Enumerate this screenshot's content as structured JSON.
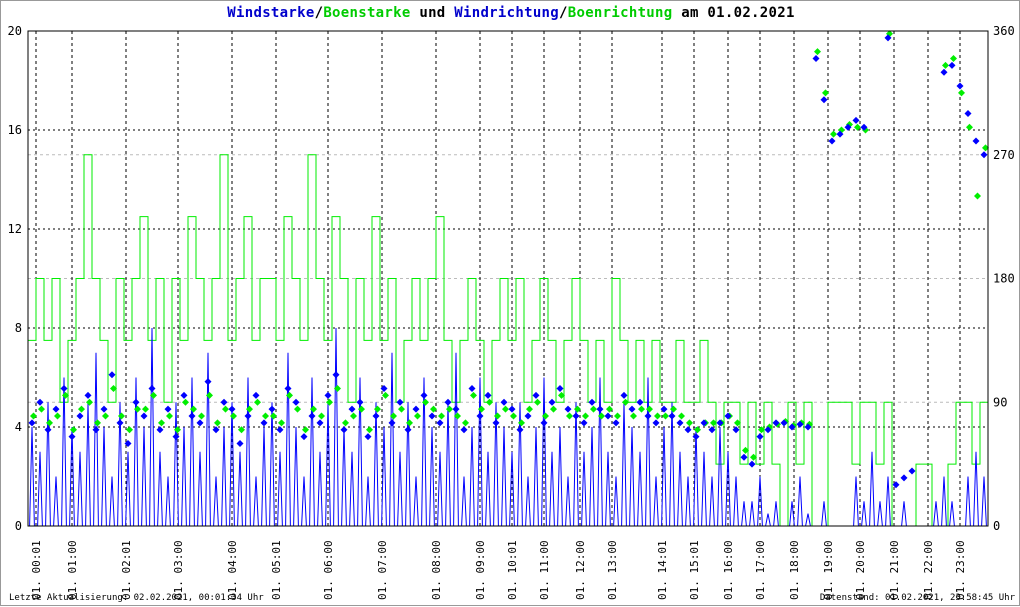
{
  "title": {
    "p1": "Windstarke",
    "s1": "/",
    "p2": "Boenstarke",
    "s2": " und ",
    "p3": "Windrichtung",
    "s3": "/",
    "p4": "Boenrichtung",
    "s4": " am 01.02.2021"
  },
  "footer": {
    "left": "Letzte Aktualisierung: 02.02.2021, 00:01:34 Uhr",
    "right": "Datenstand: 01.02.2021, 23:58:45 Uhr"
  },
  "colors": {
    "speed": "#0000ff",
    "gust": "#00ee00",
    "grid": "#000000",
    "grid_minor": "#bbbbbb"
  },
  "chart_data": {
    "type": "line",
    "title": "Windstarke/Boenstarke und Windrichtung/Boenrichtung am 01.02.2021",
    "x_samples": 120,
    "y_left": {
      "min": 0,
      "max": 20,
      "ticks": [
        0,
        4,
        8,
        12,
        16,
        20
      ]
    },
    "y_right": {
      "min": 0,
      "max": 360,
      "ticks": [
        0,
        90,
        180,
        270,
        360
      ]
    },
    "x_ticks": [
      {
        "pos": 0.5,
        "label": "01. 00:01"
      },
      {
        "pos": 5,
        "label": "01. 01:00"
      },
      {
        "pos": 11.75,
        "label": "01. 02:01"
      },
      {
        "pos": 18.25,
        "label": "01. 03:00"
      },
      {
        "pos": 25,
        "label": "01. 04:00"
      },
      {
        "pos": 30.5,
        "label": "01. 05:01"
      },
      {
        "pos": 37,
        "label": "01. 06:00"
      },
      {
        "pos": 43.75,
        "label": "01. 07:00"
      },
      {
        "pos": 50.5,
        "label": "01. 08:00"
      },
      {
        "pos": 56,
        "label": "01. 09:00"
      },
      {
        "pos": 60,
        "label": "01. 10:01"
      },
      {
        "pos": 64,
        "label": "01. 11:00"
      },
      {
        "pos": 68.5,
        "label": "01. 12:00"
      },
      {
        "pos": 72.5,
        "label": "01. 13:00"
      },
      {
        "pos": 78.75,
        "label": "01. 14:01"
      },
      {
        "pos": 82.75,
        "label": "01. 15:01"
      },
      {
        "pos": 87,
        "label": "01. 16:00"
      },
      {
        "pos": 91,
        "label": "01. 17:00"
      },
      {
        "pos": 95.25,
        "label": "01. 18:00"
      },
      {
        "pos": 99.5,
        "label": "01. 19:00"
      },
      {
        "pos": 103.5,
        "label": "01. 20:00"
      },
      {
        "pos": 107.75,
        "label": "01. 21:00"
      },
      {
        "pos": 112,
        "label": "01. 22:00"
      },
      {
        "pos": 116,
        "label": "01. 23:00"
      }
    ],
    "series": [
      {
        "name": "Windstarke",
        "axis": "left",
        "style": "line",
        "values": [
          4,
          3,
          5,
          2,
          6,
          4,
          3,
          5,
          7,
          4,
          2,
          5,
          3,
          6,
          4,
          8,
          3,
          2,
          5,
          4,
          6,
          3,
          7,
          2,
          4,
          5,
          3,
          6,
          2,
          4,
          5,
          3,
          7,
          4,
          2,
          6,
          3,
          5,
          8,
          4,
          3,
          6,
          2,
          5,
          4,
          7,
          3,
          5,
          2,
          6,
          4,
          3,
          5,
          7,
          2,
          4,
          6,
          3,
          5,
          4,
          3,
          5,
          2,
          4,
          6,
          3,
          4,
          2,
          5,
          3,
          4,
          6,
          3,
          2,
          5,
          4,
          3,
          6,
          2,
          4,
          5,
          3,
          2,
          4,
          3,
          2,
          4,
          3,
          2,
          1,
          1,
          2,
          0.5,
          1,
          0,
          1,
          2,
          0.5,
          0,
          1,
          0,
          0,
          0,
          2,
          1,
          3,
          1,
          2,
          0,
          1,
          0,
          0,
          0,
          1,
          2,
          1,
          0,
          2,
          3,
          2
        ]
      },
      {
        "name": "Boenstarke",
        "axis": "left",
        "style": "step",
        "values": [
          7.5,
          10,
          7.5,
          10,
          5,
          7.5,
          10,
          15,
          10,
          7.5,
          5,
          10,
          7.5,
          10,
          12.5,
          7.5,
          10,
          5,
          10,
          7.5,
          12.5,
          10,
          7.5,
          10,
          15,
          7.5,
          10,
          12.5,
          7.5,
          10,
          10,
          7.5,
          12.5,
          10,
          7.5,
          15,
          10,
          7.5,
          12.5,
          10,
          5,
          10,
          7.5,
          12.5,
          7.5,
          10,
          5,
          7.5,
          10,
          7.5,
          10,
          12.5,
          7.5,
          5,
          7.5,
          10,
          7.5,
          5,
          7.5,
          10,
          7.5,
          10,
          5,
          7.5,
          10,
          7.5,
          5,
          7.5,
          10,
          7.5,
          5,
          7.5,
          5,
          10,
          7.5,
          5,
          7.5,
          5,
          7.5,
          5,
          5,
          7.5,
          5,
          5,
          7.5,
          5,
          2.5,
          5,
          5,
          2.5,
          5,
          2.5,
          5,
          2.5,
          0,
          5,
          2.5,
          5,
          0,
          0,
          5,
          5,
          5,
          2.5,
          5,
          5,
          2.5,
          5,
          0,
          0,
          0,
          2.5,
          2.5,
          0,
          0,
          2.5,
          5,
          5,
          2.5,
          5
        ]
      },
      {
        "name": "Windrichtung",
        "axis": "right",
        "style": "points",
        "values": [
          75,
          90,
          70,
          85,
          100,
          65,
          80,
          95,
          70,
          85,
          110,
          75,
          60,
          90,
          80,
          100,
          70,
          85,
          65,
          95,
          80,
          75,
          105,
          70,
          90,
          85,
          60,
          80,
          95,
          75,
          85,
          70,
          100,
          90,
          65,
          80,
          75,
          95,
          110,
          70,
          85,
          90,
          65,
          80,
          100,
          75,
          90,
          70,
          85,
          95,
          80,
          75,
          90,
          85,
          70,
          100,
          80,
          95,
          75,
          90,
          85,
          70,
          80,
          95,
          75,
          90,
          100,
          85,
          80,
          75,
          90,
          85,
          80,
          75,
          95,
          85,
          90,
          80,
          75,
          85,
          80,
          75,
          70,
          65,
          75,
          70,
          75,
          80,
          70,
          50,
          45,
          65,
          70,
          75,
          75,
          72,
          74,
          72,
          340,
          310,
          280,
          285,
          290,
          295,
          290,
          null,
          null,
          355,
          30,
          35,
          40,
          null,
          null,
          null,
          330,
          335,
          320,
          300,
          280,
          270
        ]
      },
      {
        "name": "Boenrichtung",
        "axis": "right",
        "style": "points",
        "values": [
          80,
          85,
          75,
          80,
          95,
          70,
          85,
          90,
          75,
          80,
          100,
          80,
          70,
          85,
          85,
          95,
          75,
          80,
          70,
          90,
          85,
          80,
          95,
          75,
          85,
          80,
          70,
          85,
          90,
          80,
          80,
          75,
          95,
          85,
          70,
          85,
          80,
          90,
          100,
          75,
          80,
          85,
          70,
          85,
          95,
          80,
          85,
          75,
          80,
          90,
          85,
          80,
          85,
          80,
          75,
          95,
          85,
          90,
          80,
          85,
          80,
          75,
          85,
          90,
          80,
          85,
          95,
          80,
          85,
          80,
          85,
          80,
          85,
          80,
          90,
          80,
          85,
          85,
          80,
          80,
          85,
          80,
          75,
          70,
          75,
          75,
          75,
          80,
          75,
          55,
          50,
          70,
          72,
          74,
          76,
          73,
          75,
          74,
          345,
          315,
          285,
          288,
          292,
          290,
          288,
          null,
          null,
          358,
          null,
          null,
          null,
          null,
          null,
          null,
          335,
          340,
          315,
          290,
          240,
          275
        ]
      }
    ]
  }
}
